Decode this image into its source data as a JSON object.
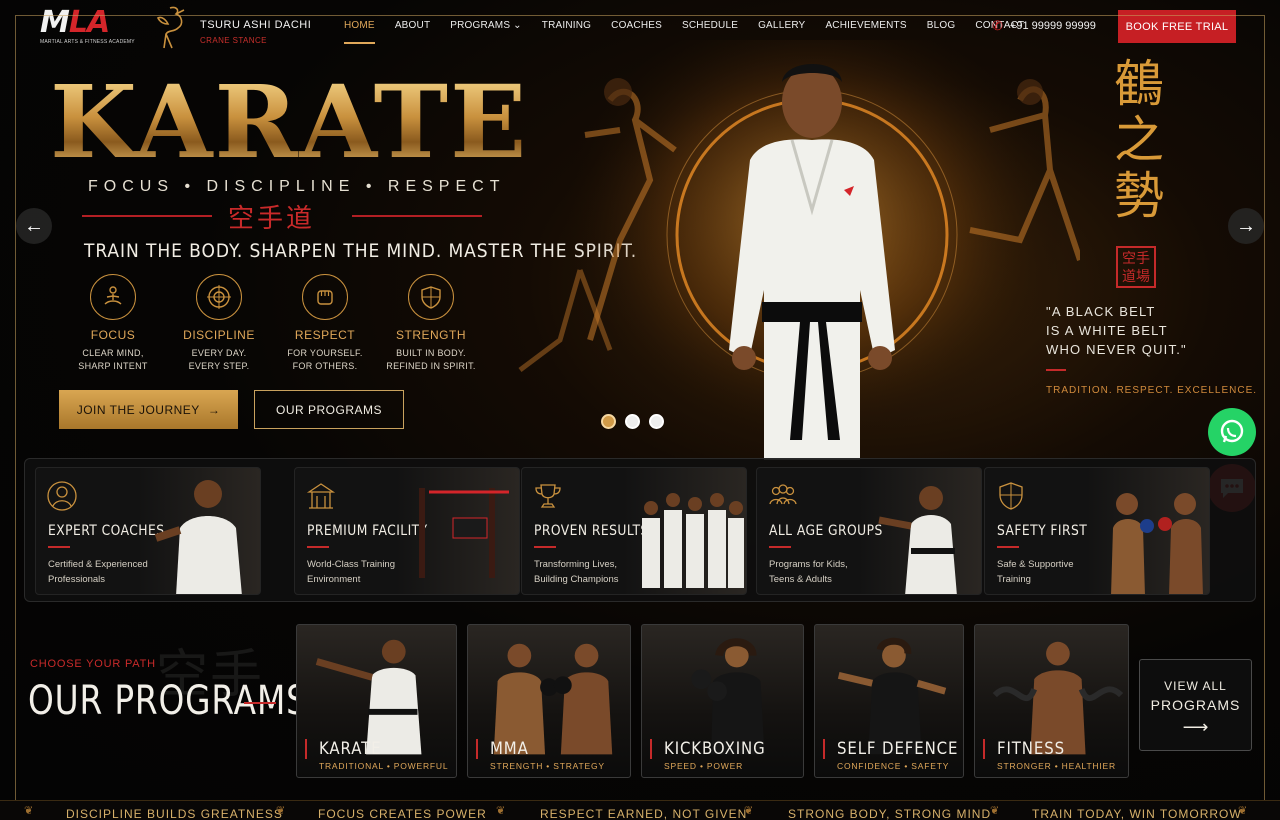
{
  "brand": {
    "logo_text_1": "M",
    "logo_text_2": "LA",
    "logo_sub": "MARTIAL ARTS & FITNESS ACADEMY",
    "stance_name": "TSURU ASHI DACHI",
    "stance_sub": "CRANE STANCE"
  },
  "nav": {
    "items": [
      {
        "label": "HOME",
        "active": true
      },
      {
        "label": "ABOUT"
      },
      {
        "label": "PROGRAMS ⌄"
      },
      {
        "label": "TRAINING"
      },
      {
        "label": "COACHES"
      },
      {
        "label": "SCHEDULE"
      },
      {
        "label": "GALLERY"
      },
      {
        "label": "ACHIEVEMENTS"
      },
      {
        "label": "BLOG"
      },
      {
        "label": "CONTACT"
      }
    ],
    "phone": "+91 99999 99999",
    "cta": "BOOK FREE TRIAL"
  },
  "hero": {
    "title": "KARATE",
    "tagline": "FOCUS • DISCIPLINE • RESPECT",
    "kanji": "空手道",
    "subtitle": "TRAIN THE BODY. SHARPEN THE MIND. MASTER THE SPIRIT.",
    "values": [
      {
        "title": "FOCUS",
        "desc1": "CLEAR MIND,",
        "desc2": "SHARP INTENT",
        "icon": "meditation-icon"
      },
      {
        "title": "DISCIPLINE",
        "desc1": "EVERY DAY.",
        "desc2": "EVERY STEP.",
        "icon": "target-icon"
      },
      {
        "title": "RESPECT",
        "desc1": "FOR YOURSELF.",
        "desc2": "FOR OTHERS.",
        "icon": "fist-icon"
      },
      {
        "title": "STRENGTH",
        "desc1": "BUILT IN BODY.",
        "desc2": "REFINED IN SPIRIT.",
        "icon": "shield-icon"
      }
    ],
    "btn_journey": "JOIN THE JOURNEY",
    "btn_programs": "OUR PROGRAMS",
    "right_kanji": "鶴之勢",
    "seal": "空手道場",
    "quote_1": "\"A BLACK BELT",
    "quote_2": "IS A WHITE BELT",
    "quote_3": "WHO NEVER QUIT.\"",
    "tradition": "TRADITION. RESPECT. EXCELLENCE.",
    "slides": 3,
    "active_slide": 1
  },
  "features": [
    {
      "title": "EXPERT COACHES",
      "desc1": "Certified & Experienced",
      "desc2": "Professionals",
      "icon": "coach-icon"
    },
    {
      "title": "PREMIUM FACILITY",
      "desc1": "World-Class Training",
      "desc2": "Environment",
      "icon": "dojo-icon"
    },
    {
      "title": "PROVEN RESULTS",
      "desc1": "Transforming Lives,",
      "desc2": "Building Champions",
      "icon": "trophy-icon"
    },
    {
      "title": "ALL AGE GROUPS",
      "desc1": "Programs for Kids,",
      "desc2": "Teens & Adults",
      "icon": "group-icon"
    },
    {
      "title": "SAFETY FIRST",
      "desc1": "Safe & Supportive",
      "desc2": "Training",
      "icon": "shield-icon"
    }
  ],
  "programs": {
    "eyebrow": "CHOOSE YOUR PATH",
    "heading": "OUR PROGRAMS",
    "kanji_bg": "空手",
    "items": [
      {
        "name": "KARATE",
        "sub": "TRADITIONAL • POWERFUL"
      },
      {
        "name": "MMA",
        "sub": "STRENGTH • STRATEGY"
      },
      {
        "name": "KICKBOXING",
        "sub": "SPEED • POWER"
      },
      {
        "name": "SELF DEFENCE",
        "sub": "CONFIDENCE • SAFETY"
      },
      {
        "name": "FITNESS",
        "sub": "STRONGER • HEALTHIER"
      }
    ],
    "view_all_1": "VIEW ALL",
    "view_all_2": "PROGRAMS"
  },
  "ticker": [
    "DISCIPLINE BUILDS GREATNESS",
    "FOCUS CREATES POWER",
    "RESPECT EARNED, NOT GIVEN",
    "STRONG BODY, STRONG MIND",
    "TRAIN TODAY, WIN TOMORROW"
  ],
  "colors": {
    "accent_gold": "#e0a85a",
    "accent_red": "#c61f24",
    "background": "#050505"
  }
}
